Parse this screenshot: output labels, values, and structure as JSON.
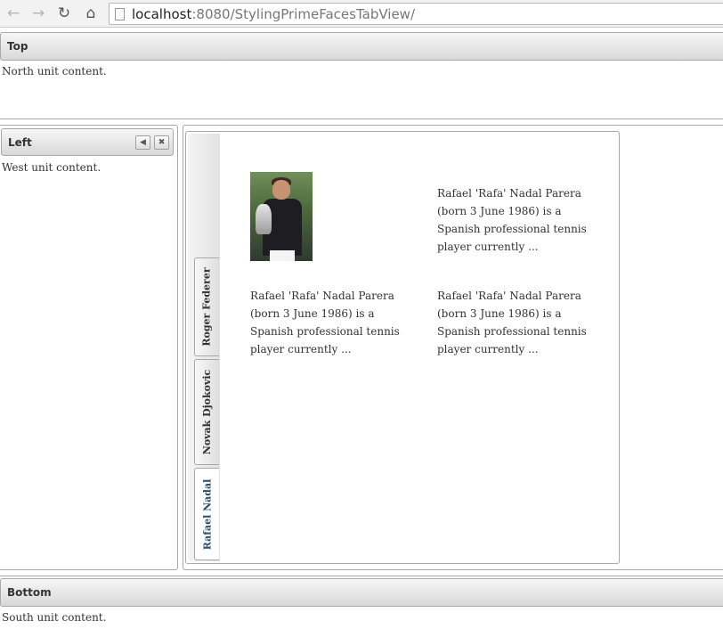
{
  "browser": {
    "back_icon": "arrow-left",
    "forward_icon": "arrow-right",
    "reload_icon": "reload",
    "home_icon": "home",
    "url_host": "localhost",
    "url_path": ":8080/StylingPrimeFacesTabView/"
  },
  "north": {
    "title": "Top",
    "content": "North unit content."
  },
  "west": {
    "title": "Left",
    "content": "West unit content.",
    "collapse_icon": "triangle-left",
    "close_icon": "close"
  },
  "south": {
    "title": "Bottom",
    "content": "South unit content."
  },
  "tabview": {
    "tabs": [
      {
        "label": "Roger Federer"
      },
      {
        "label": "Novak Djokovic"
      },
      {
        "label": "Rafael Nadal"
      }
    ],
    "active_tab": "Rafael Nadal",
    "panel": {
      "bio_top_right": "Rafael 'Rafa' Nadal Parera (born 3 June 1986) is a Spanish professional tennis player currently ...",
      "bio_bottom_left": "Rafael 'Rafa' Nadal Parera (born 3 June 1986) is a Spanish professional tennis player currently ...",
      "bio_bottom_right": "Rafael 'Rafa' Nadal Parera (born 3 June 1986) is a Spanish professional tennis player currently ..."
    }
  }
}
